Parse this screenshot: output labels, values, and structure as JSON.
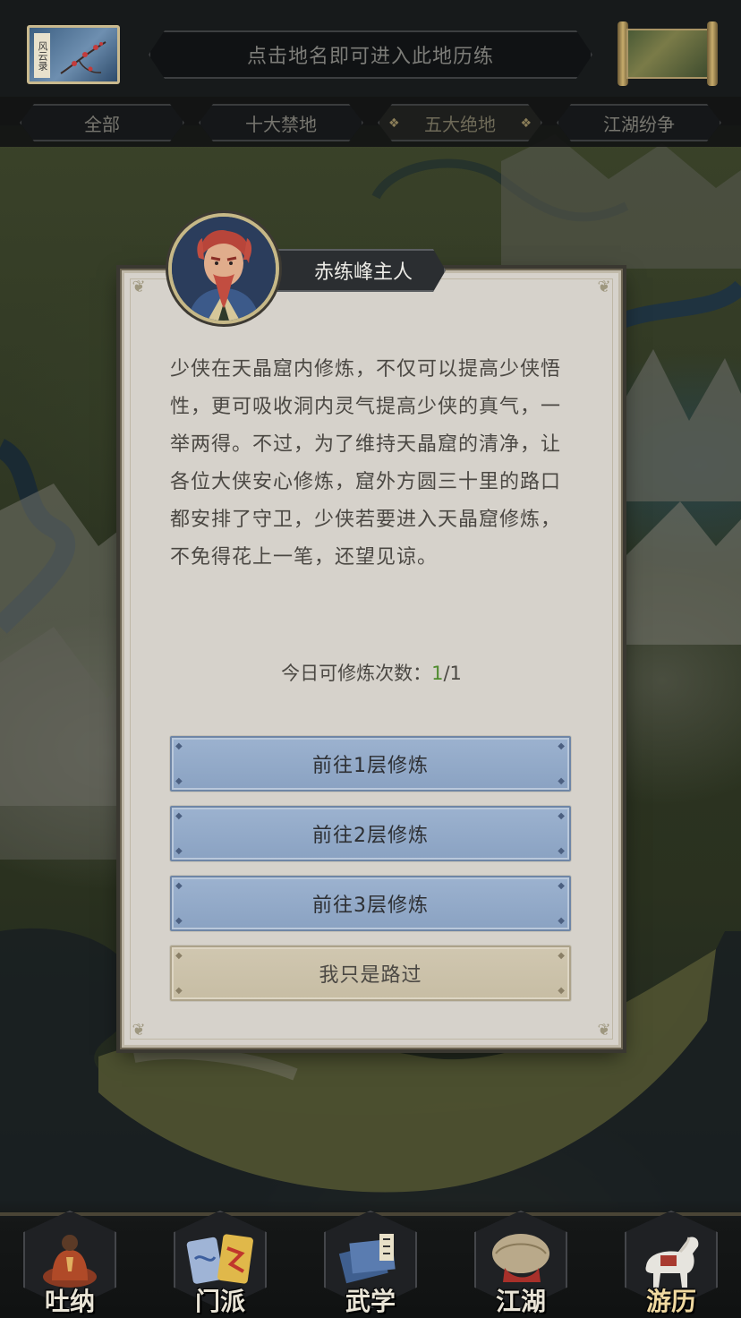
{
  "topbar": {
    "logo_text": "风云录",
    "hint": "点击地名即可进入此地历练"
  },
  "tabs": [
    {
      "label": "全部",
      "active": false
    },
    {
      "label": "十大禁地",
      "active": false
    },
    {
      "label": "五大绝地",
      "active": true
    },
    {
      "label": "江湖纷争",
      "active": false
    }
  ],
  "dialog": {
    "npc_name": "赤练峰主人",
    "text": "少侠在天晶窟内修炼，不仅可以提高少侠悟性，更可吸收洞内灵气提高少侠的真气，一举两得。不过，为了维持天晶窟的清净，让各位大侠安心修炼，窟外方圆三十里的路口都安排了守卫，少侠若要进入天晶窟修炼，不免得花上一笔，还望见谅。",
    "count_label": "今日可修炼次数：",
    "count_current": "1",
    "count_total": "/1",
    "buttons": [
      {
        "label": "前往1层修炼",
        "style": "blue"
      },
      {
        "label": "前往2层修炼",
        "style": "blue"
      },
      {
        "label": "前往3层修炼",
        "style": "blue"
      },
      {
        "label": "我只是路过",
        "style": "tan"
      }
    ]
  },
  "nav": [
    {
      "label": "吐纳",
      "icon": "meditating-monk-icon",
      "active": false
    },
    {
      "label": "门派",
      "icon": "sect-banners-icon",
      "active": false
    },
    {
      "label": "武学",
      "icon": "martial-books-icon",
      "active": false
    },
    {
      "label": "江湖",
      "icon": "straw-hat-icon",
      "active": false
    },
    {
      "label": "游历",
      "icon": "white-horse-icon",
      "active": true
    }
  ],
  "colors": {
    "accent_blue": "#8aa2c2",
    "count_green": "#4f8b2e",
    "dialog_bg": "#d6d2cb",
    "nameplate_bg": "#2b2e31"
  }
}
